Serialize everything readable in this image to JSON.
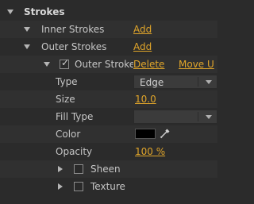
{
  "panel": {
    "strokes_title": "Strokes",
    "inner_strokes": {
      "label": "Inner Strokes",
      "action": "Add"
    },
    "outer_strokes": {
      "label": "Outer Strokes",
      "action": "Add"
    },
    "outer_stroke_item": {
      "label": "Outer Stroke",
      "checked": true,
      "delete_label": "Delete",
      "move_label": "Move U"
    },
    "properties": {
      "type": {
        "label": "Type",
        "value": "Edge"
      },
      "size": {
        "label": "Size",
        "value": "10.0"
      },
      "fill_type": {
        "label": "Fill Type",
        "value": ""
      },
      "color": {
        "label": "Color",
        "value": "#000000"
      },
      "opacity": {
        "label": "Opacity",
        "value": "100 %"
      }
    },
    "sheen": {
      "label": "Sheen",
      "checked": false
    },
    "texture": {
      "label": "Texture",
      "checked": false
    }
  }
}
